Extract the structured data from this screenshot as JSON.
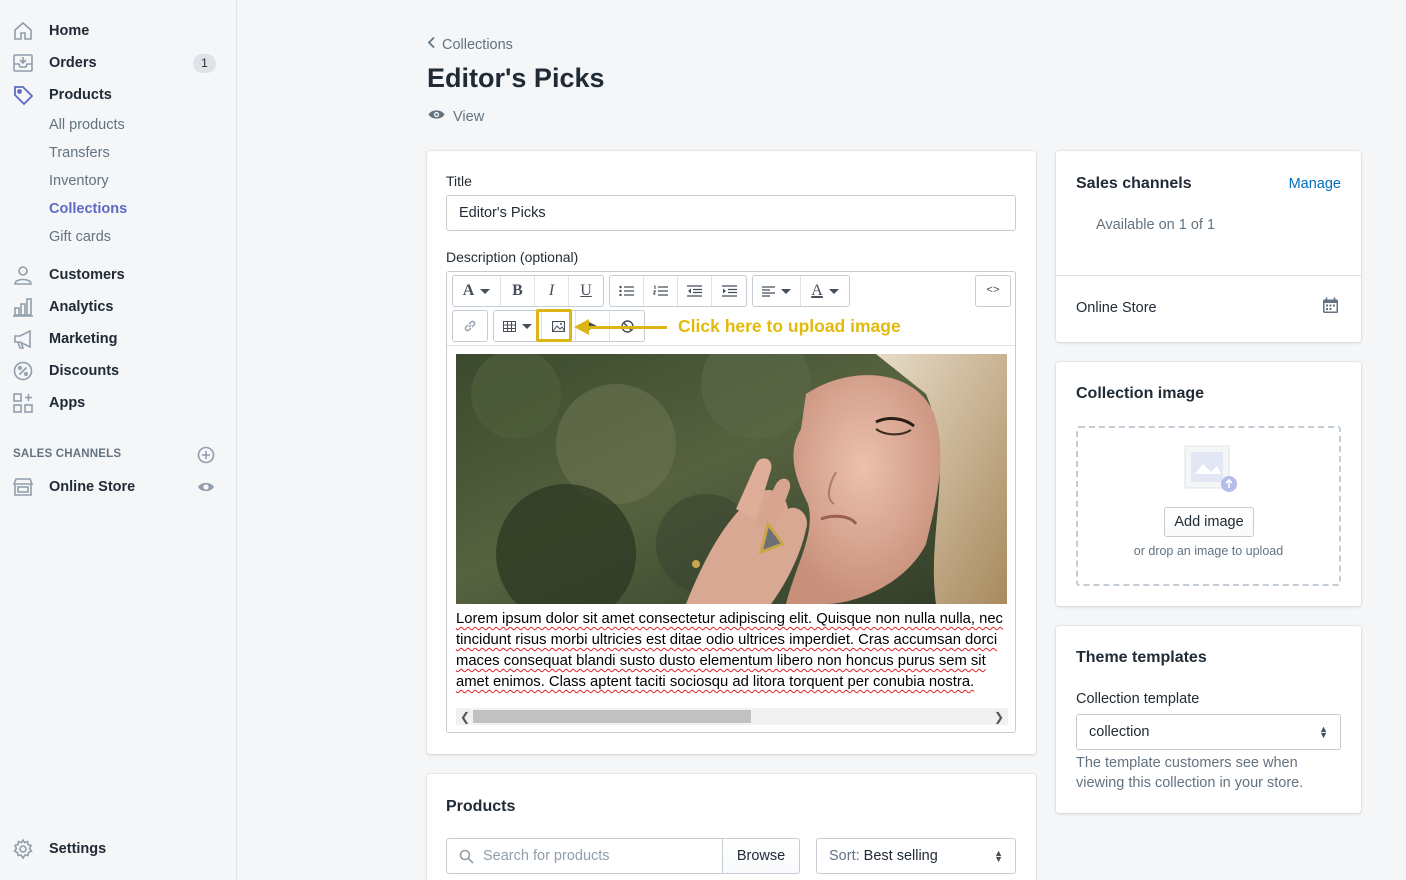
{
  "sidebar": {
    "items": [
      {
        "label": "Home",
        "icon": "home-icon"
      },
      {
        "label": "Orders",
        "icon": "orders-icon",
        "badge": "1"
      },
      {
        "label": "Products",
        "icon": "tag-icon"
      }
    ],
    "product_subitems": [
      "All products",
      "Transfers",
      "Inventory",
      "Collections",
      "Gift cards"
    ],
    "active_subitem": "Collections",
    "more_items": [
      {
        "label": "Customers",
        "icon": "person-icon"
      },
      {
        "label": "Analytics",
        "icon": "bar-chart-icon"
      },
      {
        "label": "Marketing",
        "icon": "megaphone-icon"
      },
      {
        "label": "Discounts",
        "icon": "discount-icon"
      },
      {
        "label": "Apps",
        "icon": "apps-icon"
      }
    ],
    "sales_channels_title": "SALES CHANNELS",
    "online_store": "Online Store",
    "settings": "Settings"
  },
  "header": {
    "breadcrumb": "Collections",
    "title": "Editor's Picks",
    "view_label": "View"
  },
  "form": {
    "title_label": "Title",
    "title_value": "Editor's Picks",
    "description_label": "Description (optional)",
    "callout": "Click here to upload image",
    "callout_color": "#e4ba0a",
    "body_text": "Lorem ipsum dolor sit amet consectetur adipiscing elit. Quisque non nulla nulla, nec tincidunt risus morbi ultricies est ditae odio ultrices imperdiet. Cras accumsan dorci maces consequat blandi susto dusto elementum libero non honcus purus sem sit amet enimos. Class aptent taciti sociosqu ad litora torquent per conubia nostra."
  },
  "products": {
    "title": "Products",
    "search_placeholder": "Search for products",
    "browse": "Browse",
    "sort_label": "Sort:",
    "sort_value": "Best selling"
  },
  "sales_channels": {
    "title": "Sales channels",
    "manage": "Manage",
    "available": "Available on 1 of 1",
    "online_store": "Online Store"
  },
  "collection_image": {
    "title": "Collection image",
    "add_image": "Add image",
    "drop_text": "or drop an image to upload"
  },
  "theme_templates": {
    "title": "Theme templates",
    "label": "Collection template",
    "value": "collection",
    "help": "The template customers see when viewing this collection in your store."
  },
  "colors": {
    "accent": "#5c6ac4",
    "link": "#006fbb",
    "highlight": "#dcb616"
  }
}
